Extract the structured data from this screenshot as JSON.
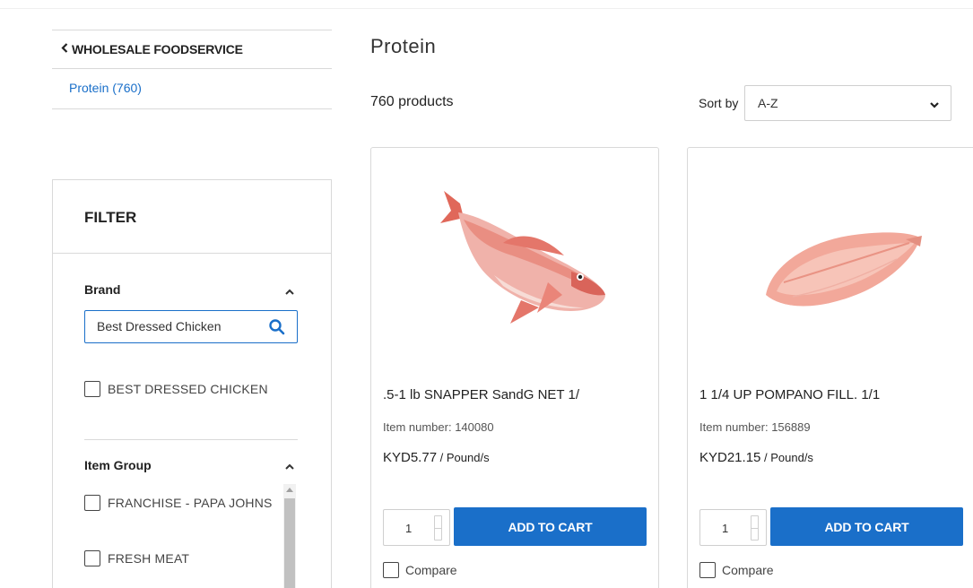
{
  "sidebar": {
    "breadcrumb": "WHOLESALE FOODSERVICE",
    "category_link": "Protein (760)"
  },
  "filter": {
    "title": "FILTER",
    "brand": {
      "title": "Brand",
      "search_value": "Best Dressed Chicken",
      "options": [
        "BEST DRESSED CHICKEN"
      ]
    },
    "item_group": {
      "title": "Item Group",
      "options": [
        "FRANCHISE - PAPA JOHNS",
        "FRESH MEAT"
      ]
    }
  },
  "main": {
    "title": "Protein",
    "count": "760 products",
    "sort_label": "Sort by",
    "sort_value": "A-Z"
  },
  "products": [
    {
      "name": ".5-1 lb SNAPPER SandG NET 1/",
      "item_number": "Item number: 140080",
      "price": "KYD5.77",
      "unit": " / Pound/s",
      "qty": "1",
      "add_label": "ADD TO CART",
      "compare_label": "Compare",
      "image": "red-snapper-fish"
    },
    {
      "name": "1 1/4 UP POMPANO FILL. 1/1",
      "item_number": "Item number: 156889",
      "price": "KYD21.15",
      "unit": " / Pound/s",
      "qty": "1",
      "add_label": "ADD TO CART",
      "compare_label": "Compare",
      "image": "pompano-fillet"
    }
  ],
  "colors": {
    "accent": "#1a6fc9",
    "border": "#d9d9d9"
  }
}
